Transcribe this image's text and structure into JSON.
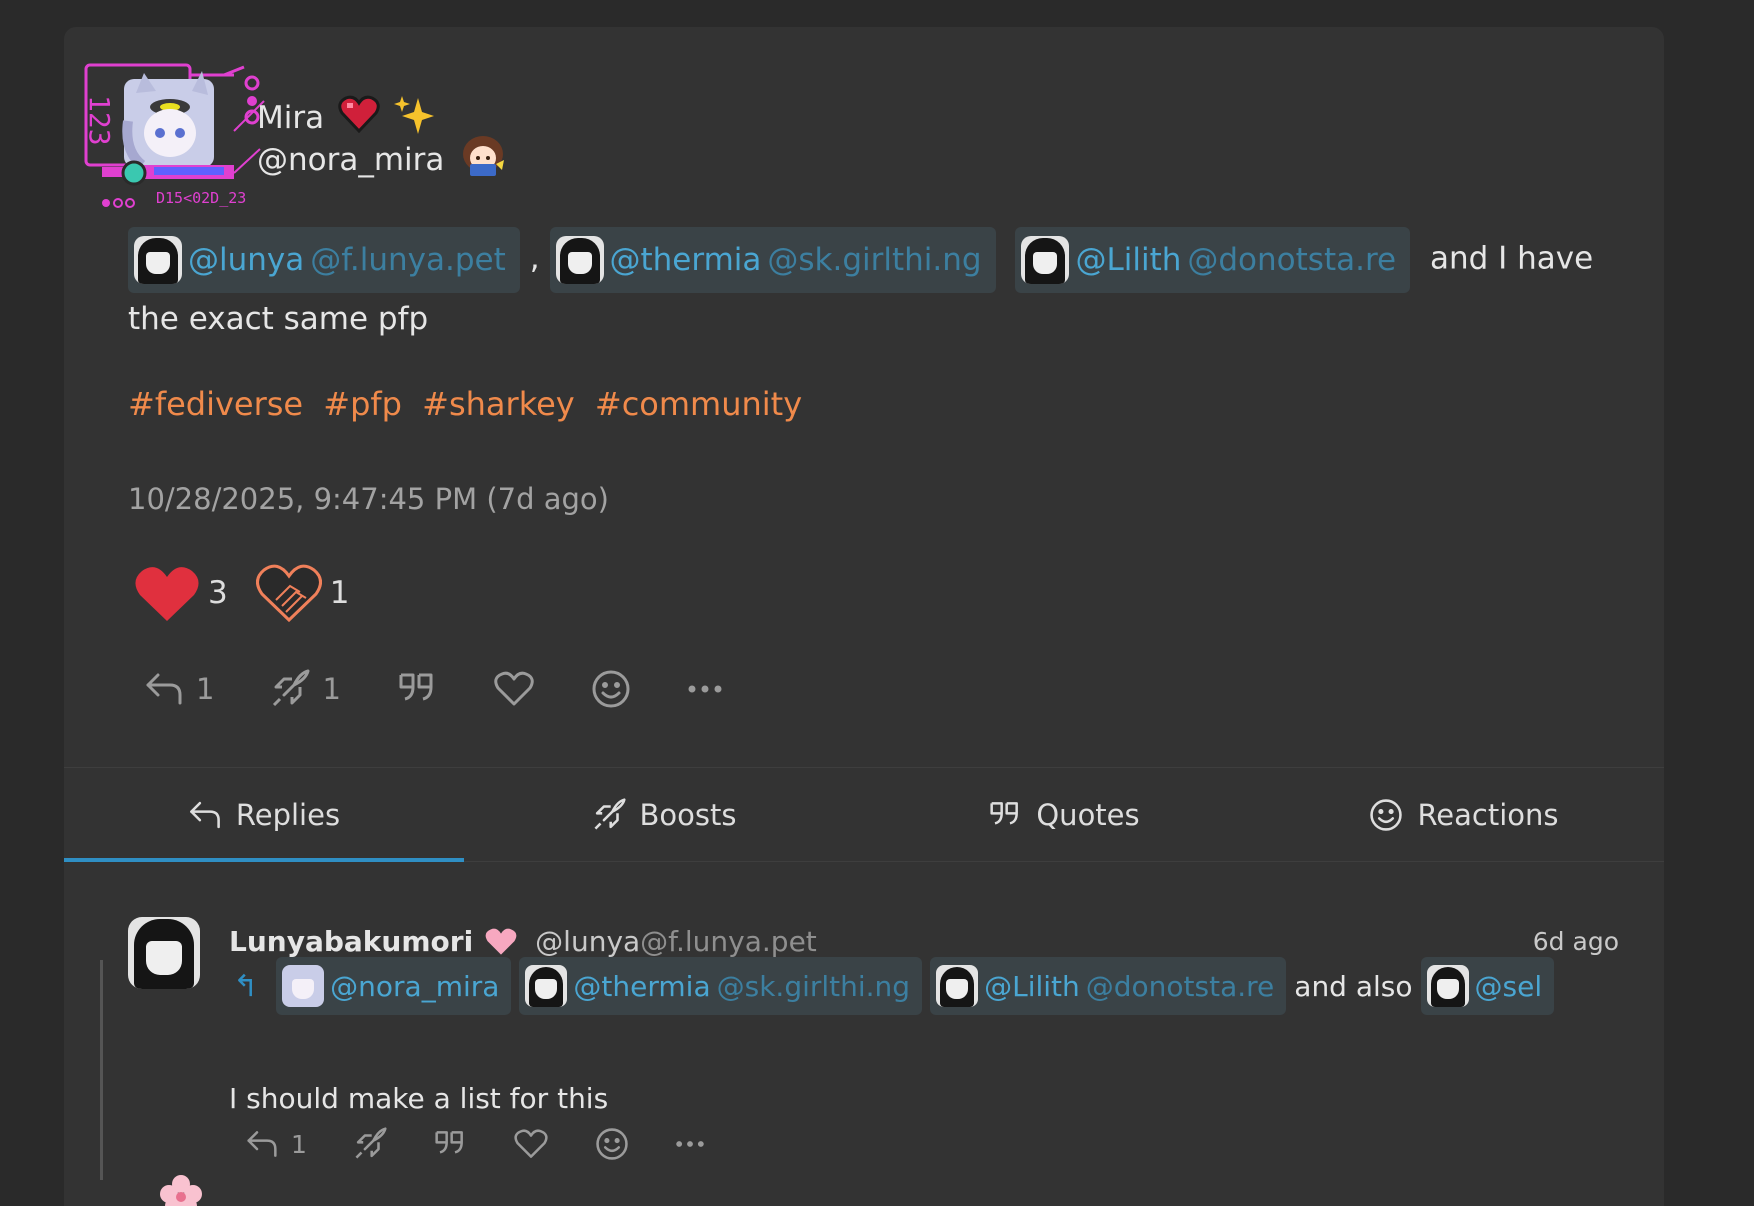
{
  "post": {
    "author_name": "Mira",
    "author_handle": "@nora_mira",
    "avatar_frame_text": "D15<02D_23",
    "avatar_frame_side_text": "123",
    "mentions": [
      {
        "user": "@lunya",
        "host": "@f.lunya.pet"
      },
      {
        "user": "@thermia",
        "host": "@sk.girlthi.ng"
      },
      {
        "user": "@Lilith",
        "host": "@donotsta.re"
      }
    ],
    "separator": ",",
    "body_tail": "and I have the exact same pfp",
    "hashtags": [
      "#fediverse",
      "#pfp",
      "#sharkey",
      "#community"
    ],
    "timestamp": "10/28/2025, 9:47:45 PM (7d ago)",
    "reactions": [
      {
        "icon": "red-heart-icon",
        "count": "3"
      },
      {
        "icon": "outline-heart-icon",
        "count": "1"
      }
    ],
    "actions": {
      "reply_count": "1",
      "boost_count": "1"
    }
  },
  "tabs": [
    {
      "label": "Replies",
      "icon": "reply-icon",
      "active": true
    },
    {
      "label": "Boosts",
      "icon": "rocket-icon",
      "active": false
    },
    {
      "label": "Quotes",
      "icon": "quote-icon",
      "active": false
    },
    {
      "label": "Reactions",
      "icon": "smiley-icon",
      "active": false
    }
  ],
  "reply": {
    "author_name": "Lunyabakumori",
    "author_user": "@lunya",
    "author_host": "@f.lunya.pet",
    "time": "6d ago",
    "mentions": [
      {
        "user": "@nora_mira",
        "host": ""
      },
      {
        "user": "@thermia",
        "host": "@sk.girlthi.ng"
      },
      {
        "user": "@Lilith",
        "host": "@donotsta.re"
      }
    ],
    "and_also": "and also",
    "last_mention": "@sel",
    "text": "I should make a list for this",
    "reply_count": "1"
  },
  "colors": {
    "background": "#2a2a2a",
    "card": "#333333",
    "accent": "#2f8fc4",
    "mention": "#4aa6d2",
    "hashtag": "#f08a4b",
    "heart": "#e0303e"
  }
}
